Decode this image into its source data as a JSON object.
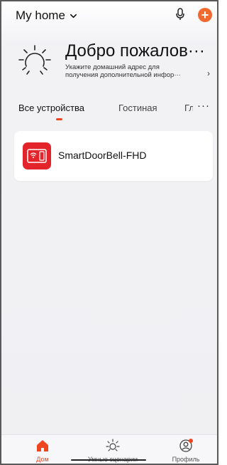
{
  "header": {
    "home_name": "My home",
    "icons": [
      "chevron-down-icon",
      "microphone-icon",
      "add-icon"
    ],
    "accent_color": "#f06a2f"
  },
  "welcome": {
    "title": "Добро пожалов···",
    "subtitle_line1": "Укажите домашний адрес для",
    "subtitle_line2": "получения дополнительной инфор···",
    "arrow": "›"
  },
  "tabs": {
    "items": [
      {
        "label": "Все устройства",
        "active": true
      },
      {
        "label": "Гостиная",
        "active": false
      },
      {
        "label": "Гл",
        "active": false
      }
    ],
    "more": "···",
    "underline_color": "#ee4520"
  },
  "devices": [
    {
      "name": "SmartDoorBell-FHD",
      "icon": "doorbell-monitor-icon",
      "icon_color": "#e3242b"
    }
  ],
  "bottom_nav": {
    "items": [
      {
        "label": "Дом",
        "icon": "home-icon",
        "active": true
      },
      {
        "label": "Умные сценарии",
        "icon": "sun-icon",
        "active": false
      },
      {
        "label": "Профиль",
        "icon": "profile-icon",
        "active": false
      }
    ],
    "active_color": "#ee4520"
  }
}
